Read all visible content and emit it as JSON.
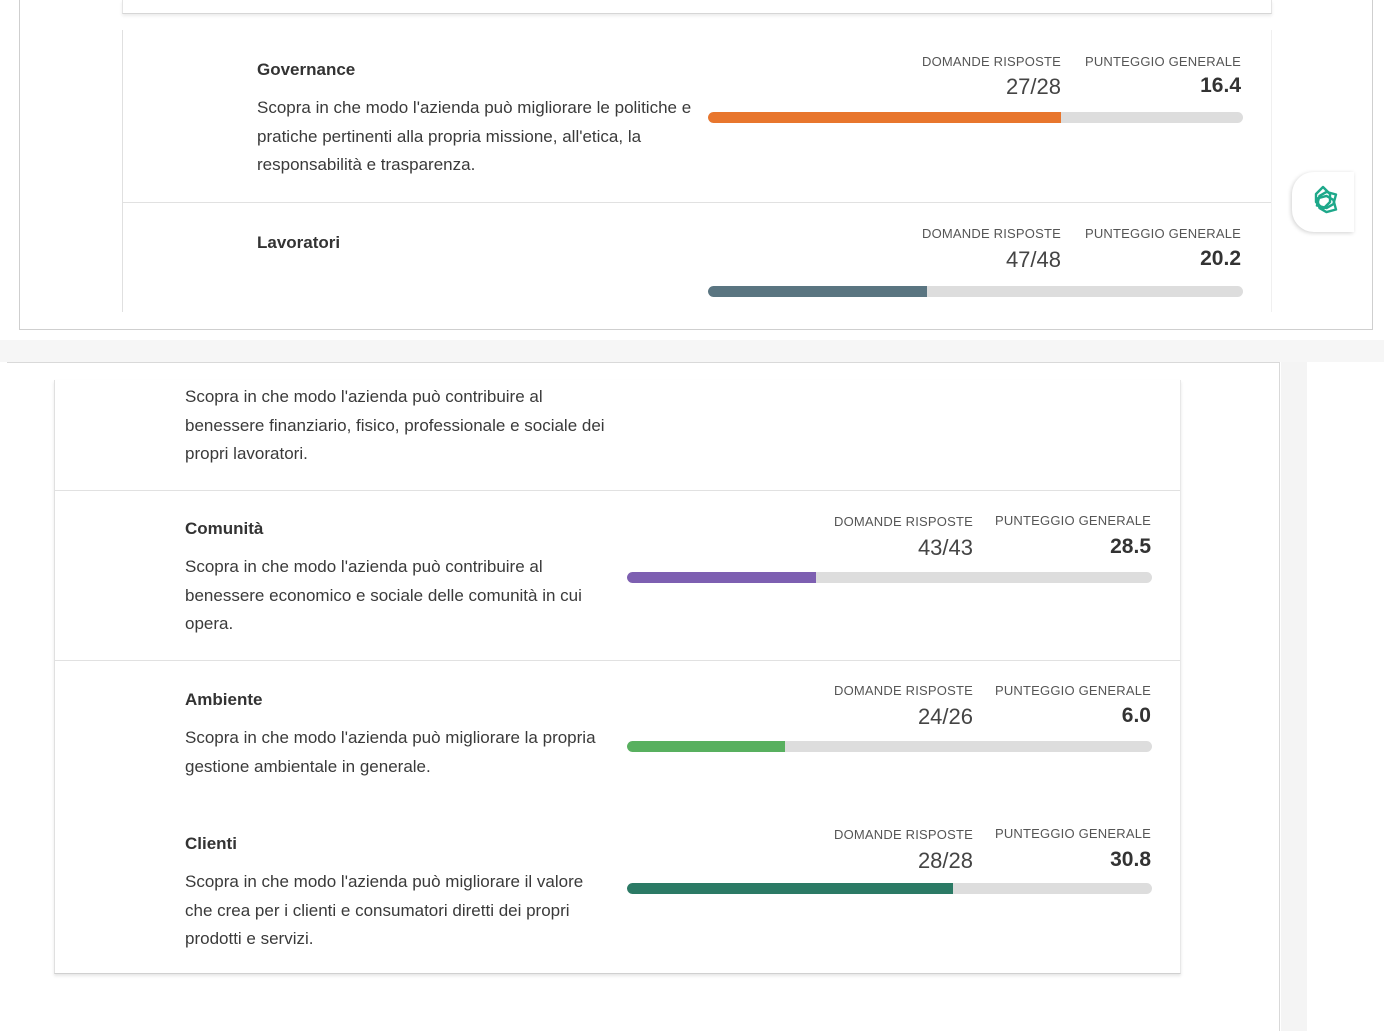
{
  "colors": {
    "governance": "#e8762d",
    "lavoratori": "#5a7581",
    "comunita": "#7d5fb1",
    "ambiente": "#58b05f",
    "clienti": "#2b7a65",
    "track": "#dddddd",
    "assistant": "#1ea88a"
  },
  "labels": {
    "questions_answered": "DOMANDE RISPOSTE",
    "overall_score": "PUNTEGGIO GENERALE"
  },
  "assistant": {
    "icon": "assistant-icon"
  },
  "areas": {
    "governance": {
      "title": "Governance",
      "description": "Scopra in che modo l'azienda può migliorare le politiche e pratiche pertinenti alla propria missione, all'etica, la responsabilità e trasparenza.",
      "answers": "27/28",
      "score": "16.4",
      "progress": 0.66
    },
    "lavoratori": {
      "title": "Lavoratori",
      "description": "Scopra in che modo l'azienda può contribuire al benessere finanziario, fisico, professionale e sociale dei propri lavoratori.",
      "answers": "47/48",
      "score": "20.2",
      "progress": 0.41
    },
    "comunita": {
      "title": "Comunità",
      "description": "Scopra in che modo l'azienda può contribuire al benessere economico e sociale delle comunità in cui opera.",
      "answers": "43/43",
      "score": "28.5",
      "progress": 0.36
    },
    "ambiente": {
      "title": "Ambiente",
      "description": "Scopra in che modo l'azienda può migliorare la propria gestione ambientale in generale.",
      "answers": "24/26",
      "score": "6.0",
      "progress": 0.3
    },
    "clienti": {
      "title": "Clienti",
      "description": "Scopra in che modo l'azienda può migliorare il valore che crea per i clienti e consumatori diretti dei propri prodotti e servizi.",
      "answers": "28/28",
      "score": "30.8",
      "progress": 0.62
    }
  }
}
